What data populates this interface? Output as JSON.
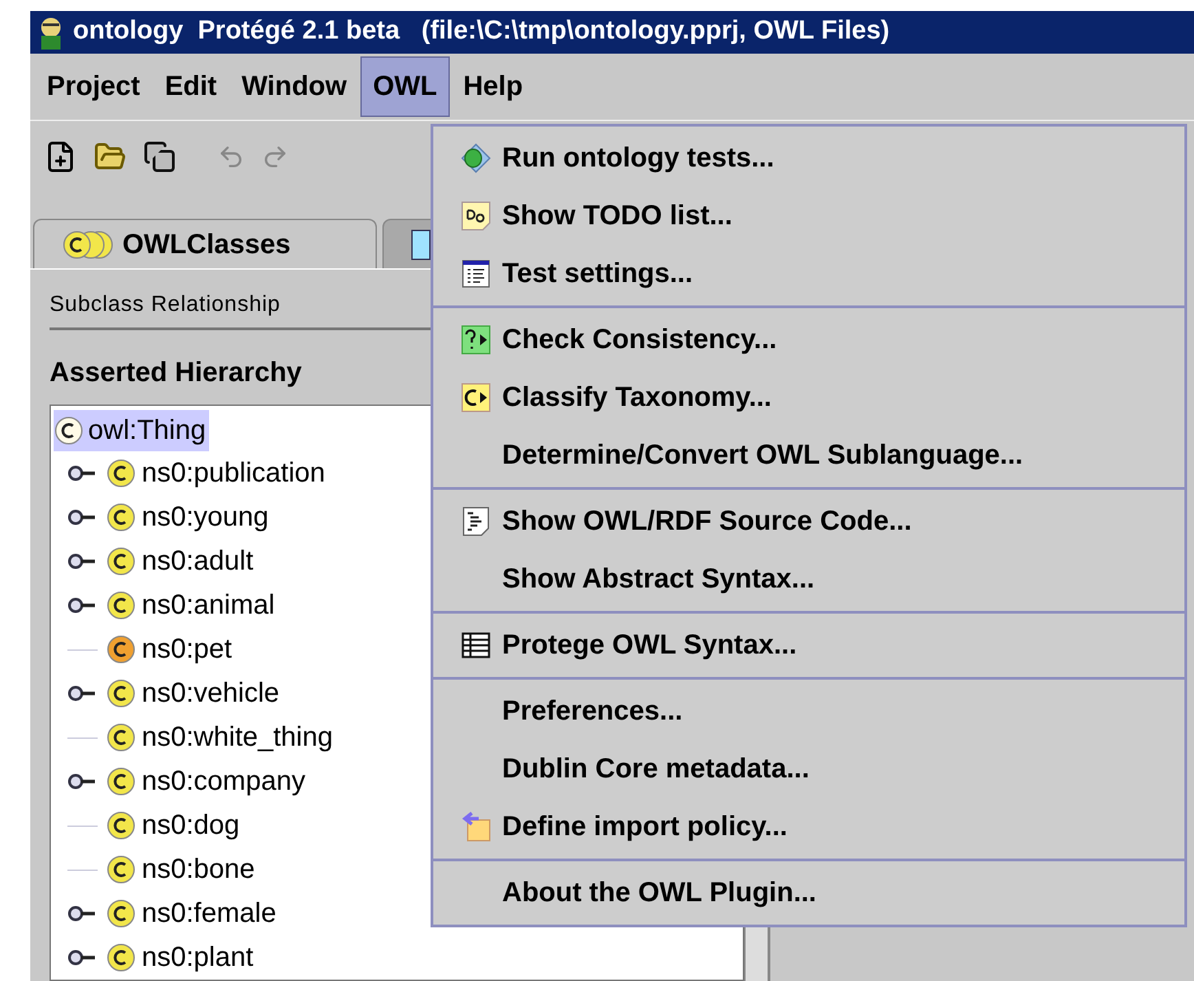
{
  "window": {
    "title": "ontology  Protégé 2.1 beta   (file:\\C:\\tmp\\ontology.pprj, OWL Files)"
  },
  "menu_bar": [
    {
      "label": "Project",
      "selected": false
    },
    {
      "label": "Edit",
      "selected": false
    },
    {
      "label": "Window",
      "selected": false
    },
    {
      "label": "OWL",
      "selected": true
    },
    {
      "label": "Help",
      "selected": false
    }
  ],
  "tabs": [
    {
      "label": "OWLClasses",
      "selected": true
    },
    {
      "selected": false
    }
  ],
  "subclass_label": "Subclass Relationship",
  "hierarchy_title": "Asserted Hierarchy",
  "tree": {
    "label": "owl:Thing",
    "selected": true,
    "children": [
      {
        "label": "ns0:publication",
        "has_children": true,
        "color": "#f2e64a"
      },
      {
        "label": "ns0:young",
        "has_children": true,
        "color": "#f2e64a"
      },
      {
        "label": "ns0:adult",
        "has_children": true,
        "color": "#f2e64a"
      },
      {
        "label": "ns0:animal",
        "has_children": true,
        "color": "#f2e64a"
      },
      {
        "label": "ns0:pet",
        "has_children": false,
        "color": "#f0a030"
      },
      {
        "label": "ns0:vehicle",
        "has_children": true,
        "color": "#f2e64a"
      },
      {
        "label": "ns0:white_thing",
        "has_children": false,
        "color": "#f2e64a"
      },
      {
        "label": "ns0:company",
        "has_children": true,
        "color": "#f2e64a"
      },
      {
        "label": "ns0:dog",
        "has_children": false,
        "color": "#f2e64a"
      },
      {
        "label": "ns0:bone",
        "has_children": false,
        "color": "#f2e64a"
      },
      {
        "label": "ns0:female",
        "has_children": true,
        "color": "#f2e64a"
      },
      {
        "label": "ns0:plant",
        "has_children": true,
        "color": "#f2e64a"
      }
    ]
  },
  "owl_menu": [
    {
      "items": [
        "Run ontology tests...",
        "Show TODO list...",
        "Test settings..."
      ]
    },
    {
      "items": [
        "Check Consistency...",
        "Classify Taxonomy...",
        "Determine/Convert OWL Sublanguage..."
      ]
    },
    {
      "items": [
        "Show OWL/RDF Source Code...",
        "Show Abstract Syntax..."
      ]
    },
    {
      "items": [
        "Protege OWL Syntax..."
      ]
    },
    {
      "items": [
        "Preferences...",
        "Dublin Core metadata...",
        "Define import policy..."
      ]
    },
    {
      "items": [
        "About the OWL Plugin..."
      ]
    }
  ]
}
